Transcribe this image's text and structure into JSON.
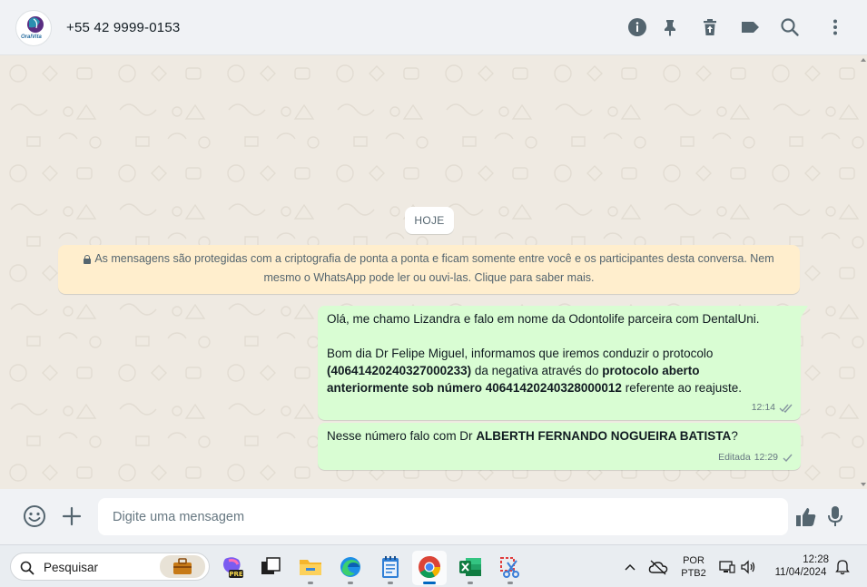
{
  "header": {
    "contact_name": "+55 42 9999-0153",
    "avatar_text": "OralVita",
    "icons": [
      "info-icon",
      "pin-icon",
      "trash-icon",
      "label-icon",
      "search-icon",
      "more-vertical-icon"
    ]
  },
  "chat": {
    "date_label": "HOJE",
    "encryption_notice_line1": "As mensagens são protegidas com a criptografia de ponta a ponta e ficam somente entre você e os participantes desta conversa. Nem",
    "encryption_notice_line2": "mesmo o WhatsApp pode ler ou ouvi-las. Clique para saber mais.",
    "messages": [
      {
        "line1": "Olá, me chamo Lizandra e falo em nome da Odontolife parceira com DentalUni.",
        "line2": "Bom dia Dr Felipe Miguel, informamos que iremos conduzir o protocolo",
        "line3_bold": "(40641420240327000233)",
        "line3_text": " da negativa através do ",
        "line3_bold2": "protocolo aberto",
        "line4_bold": "anteriormente sob número 40641420240328000012",
        "line4_text": " referente ao reajuste.",
        "time": "12:14",
        "status": "read"
      },
      {
        "text_before": "Nesse número falo com Dr ",
        "text_bold": "ALBERTH FERNANDO NOGUEIRA BATISTA",
        "text_after": "?",
        "edited_label": "Editada",
        "time": "12:29",
        "status": "sent"
      }
    ]
  },
  "composer": {
    "placeholder": "Digite uma mensagem"
  },
  "taskbar": {
    "search_placeholder": "Pesquisar",
    "language_line1": "POR",
    "language_line2": "PTB2",
    "time": "12:28",
    "date": "11/04/2024"
  },
  "colors": {
    "outgoing_bubble": "#d9fdd3",
    "notice_bg": "#ffeecd",
    "chat_bg": "#efeae2",
    "header_bg": "#f0f2f5",
    "icon_gray": "#54656f"
  }
}
